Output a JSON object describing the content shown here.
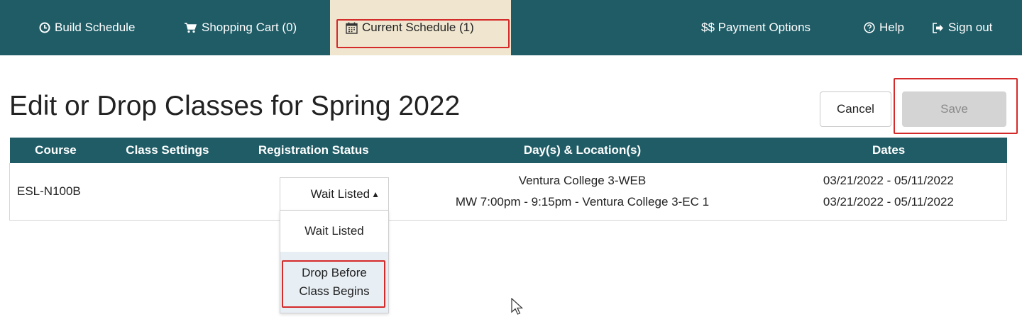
{
  "nav": {
    "build_schedule": {
      "icon": "clock-icon",
      "label": "Build Schedule"
    },
    "shopping_cart": {
      "icon": "cart-icon",
      "label": "Shopping Cart (0)"
    },
    "current_schedule": {
      "icon": "calendar-icon",
      "label": "Current Schedule (1)"
    },
    "payment_options": {
      "icon": "",
      "label": "$$ Payment Options"
    },
    "help": {
      "icon": "question-circle-icon",
      "label": "Help"
    },
    "sign_out": {
      "icon": "sign-out-icon",
      "label": "Sign out"
    }
  },
  "page": {
    "title": "Edit or Drop Classes for Spring 2022",
    "cancel_label": "Cancel",
    "save_label": "Save"
  },
  "table": {
    "headers": [
      "Course",
      "Class Settings",
      "Registration Status",
      "Day(s) & Location(s)",
      "Dates"
    ],
    "rows": [
      {
        "course": "ESL-N100B",
        "class_settings": "",
        "registration_status": "Wait Listed",
        "locations": [
          "Ventura College 3-WEB",
          "MW 7:00pm - 9:15pm - Ventura College 3-EC 1"
        ],
        "dates": [
          "03/21/2022 - 05/11/2022",
          "03/21/2022 - 05/11/2022"
        ]
      }
    ]
  },
  "status_dropdown": {
    "selected": "Wait Listed",
    "options": [
      "Wait Listed",
      "Drop Before Class Begins"
    ]
  },
  "colors": {
    "nav_background": "#1f5c66",
    "active_tab_background": "#f0e6cf",
    "highlight_border": "#d42a2a",
    "save_disabled": "#d4d4d4"
  }
}
